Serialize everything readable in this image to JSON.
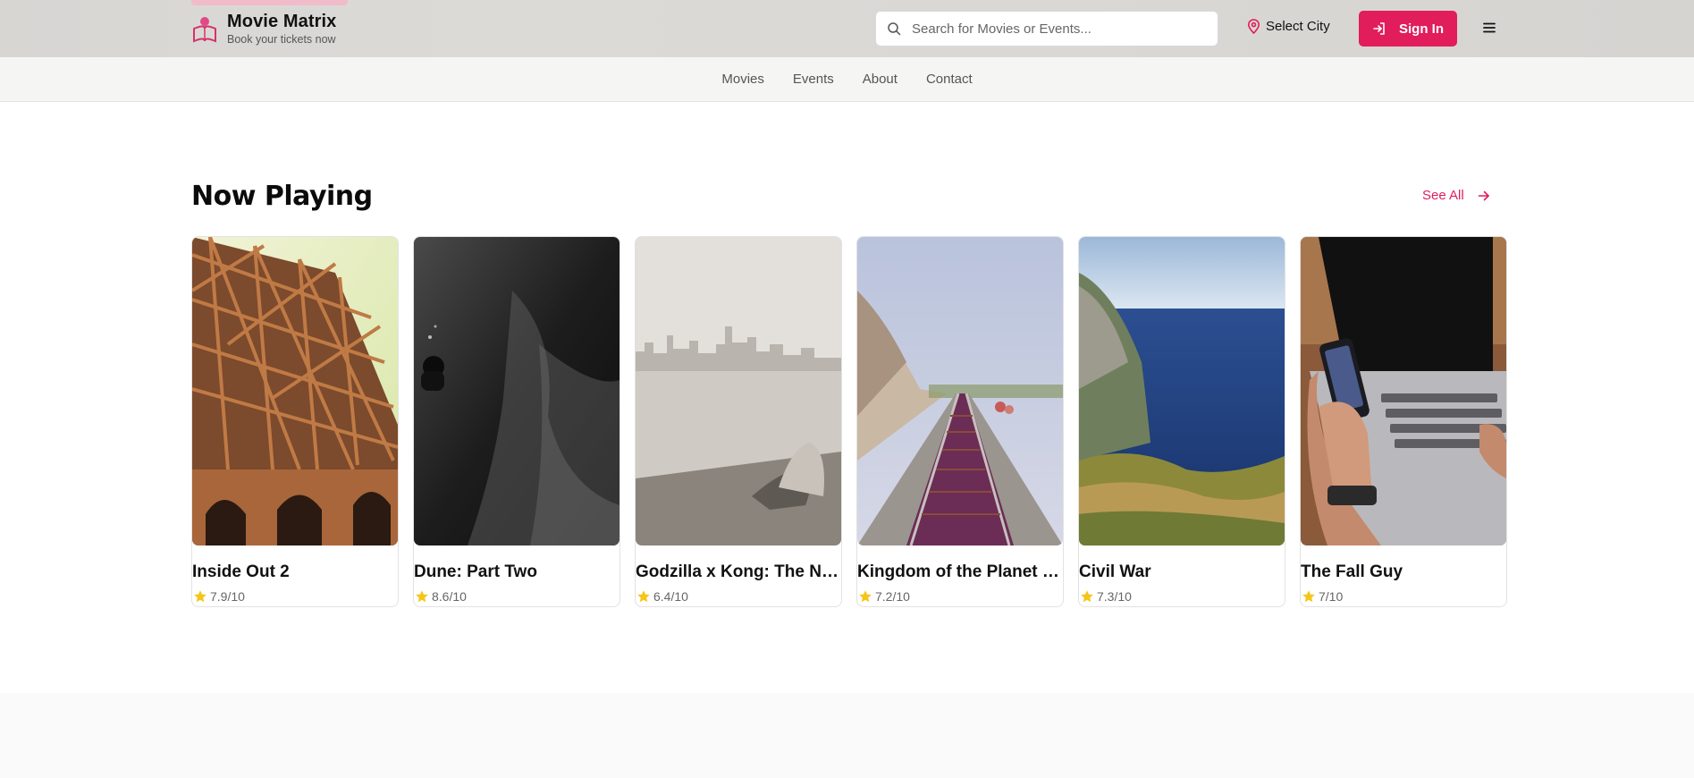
{
  "header": {
    "brand_title": "Movie Matrix",
    "brand_subtitle": "Book your tickets now",
    "search_placeholder": "Search for Movies or Events...",
    "city_label": "Select City",
    "signin_label": "Sign In",
    "accent_color": "#e11d5c"
  },
  "nav": {
    "items": [
      "Movies",
      "Events",
      "About",
      "Contact"
    ]
  },
  "section": {
    "title": "Now Playing",
    "see_all_label": "See All"
  },
  "movies": [
    {
      "title": "Inside Out 2",
      "rating": "7.9/10"
    },
    {
      "title": "Dune: Part Two",
      "rating": "8.6/10"
    },
    {
      "title": "Godzilla x Kong: The Ne...",
      "rating": "6.4/10"
    },
    {
      "title": "Kingdom of the Planet o...",
      "rating": "7.2/10"
    },
    {
      "title": "Civil War",
      "rating": "7.3/10"
    },
    {
      "title": "The Fall Guy",
      "rating": "7/10"
    }
  ]
}
